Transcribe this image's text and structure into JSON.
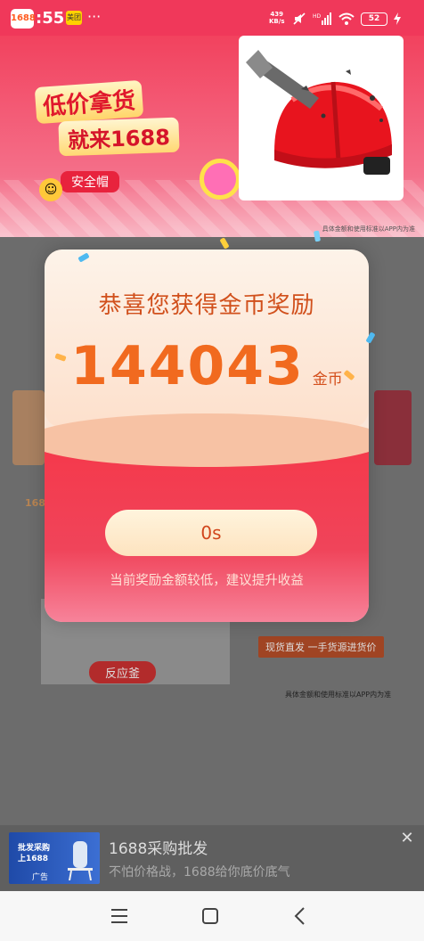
{
  "status_bar": {
    "app_icon_text": "1688",
    "time": ":55",
    "meituan_label": "美团",
    "overflow": "···",
    "net_speed": "439",
    "net_unit": "KB/s",
    "battery": "52"
  },
  "top_ad": {
    "promo_line1": "低价拿货",
    "promo_line2": "就来1688",
    "promo_tag": "安全帽",
    "disclaimer": "具体金额和使用标准以APP内为准"
  },
  "background_page": {
    "brand_text": "1688",
    "product_label": "反应釜",
    "tag_button": "现货直发 一手货源进货价",
    "disclaimer": "具体金额和使用标准以APP内为准"
  },
  "reward_modal": {
    "title": "恭喜您获得金币奖励",
    "amount": "144043",
    "unit": "金币",
    "countdown": "0s",
    "hint": "当前奖励金额较低，建议提升收益"
  },
  "bottom_ad": {
    "thumb_text_line1": "批发采购",
    "thumb_text_line2": "上1688",
    "thumb_badge": "广告",
    "title": "1688采购批发",
    "description": "不怕价格战，1688给你底价底气"
  },
  "colors": {
    "accent_red": "#f0385a",
    "amount_orange": "#f16a1f"
  },
  "icons": [
    "wifi-icon",
    "signal-icon",
    "mute-icon",
    "battery-icon",
    "menu-icon",
    "home-icon",
    "back-icon",
    "close-icon"
  ]
}
